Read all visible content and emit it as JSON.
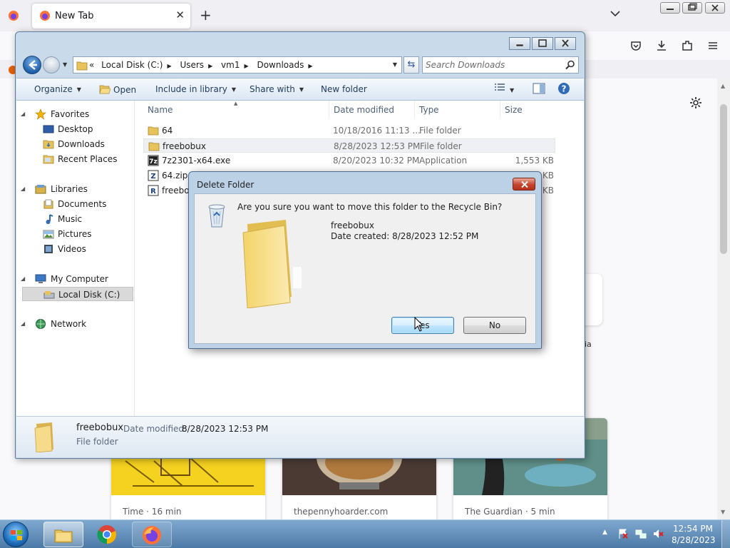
{
  "firefox": {
    "tab_title": "New Tab",
    "new_tab_symbol": "+",
    "stories": [
      {
        "source": "Time · 16 min"
      },
      {
        "source": "thepennyhoarder.com"
      },
      {
        "source": "The Guardian · 5 min"
      }
    ],
    "shortcut_label": "ia"
  },
  "explorer": {
    "breadcrumb": {
      "overflow": "«",
      "parts": [
        "Local Disk (C:)",
        "Users",
        "vm1",
        "Downloads"
      ]
    },
    "search_placeholder": "Search Downloads",
    "toolbar": {
      "organize": "Organize",
      "open": "Open",
      "include_in_library": "Include in library",
      "share_with": "Share with",
      "new_folder": "New folder"
    },
    "nav": {
      "favorites": "Favorites",
      "desktop": "Desktop",
      "downloads": "Downloads",
      "recent_places": "Recent Places",
      "libraries": "Libraries",
      "documents": "Documents",
      "music": "Music",
      "pictures": "Pictures",
      "videos": "Videos",
      "my_computer": "My Computer",
      "local_disk": "Local Disk (C:)",
      "network": "Network"
    },
    "columns": {
      "name": "Name",
      "date_modified": "Date modified",
      "type": "Type",
      "size": "Size"
    },
    "files": [
      {
        "name": "64",
        "date": "10/18/2016 11:13 ...",
        "type": "File folder",
        "size": ""
      },
      {
        "name": "freebobux",
        "date": "8/28/2023 12:53 PM",
        "type": "File folder",
        "size": ""
      },
      {
        "name": "7z2301-x64.exe",
        "date": "8/20/2023 10:32 PM",
        "type": "Application",
        "size": "1,553 KB"
      },
      {
        "name": "64.zip",
        "date": "",
        "type": "",
        "size": "KB"
      },
      {
        "name": "freebo",
        "date": "",
        "type": "",
        "size": "KB"
      }
    ],
    "details": {
      "name": "freebobux",
      "date_modified_label": "Date modified:",
      "date_modified_value": "8/28/2023 12:53 PM",
      "type": "File folder"
    }
  },
  "dialog": {
    "title": "Delete Folder",
    "question": "Are you sure you want to move this folder to the Recycle Bin?",
    "item_name": "freebobux",
    "date_created": "Date created: 8/28/2023 12:52 PM",
    "yes_label": "Yes",
    "no_label": "No"
  },
  "taskbar": {
    "time": "12:54 PM",
    "date": "8/28/2023"
  },
  "colors": {
    "accent_blue": "#1f5fa8",
    "folder_yellow": "#f3d46a",
    "dialog_close_red": "#c6442d"
  }
}
